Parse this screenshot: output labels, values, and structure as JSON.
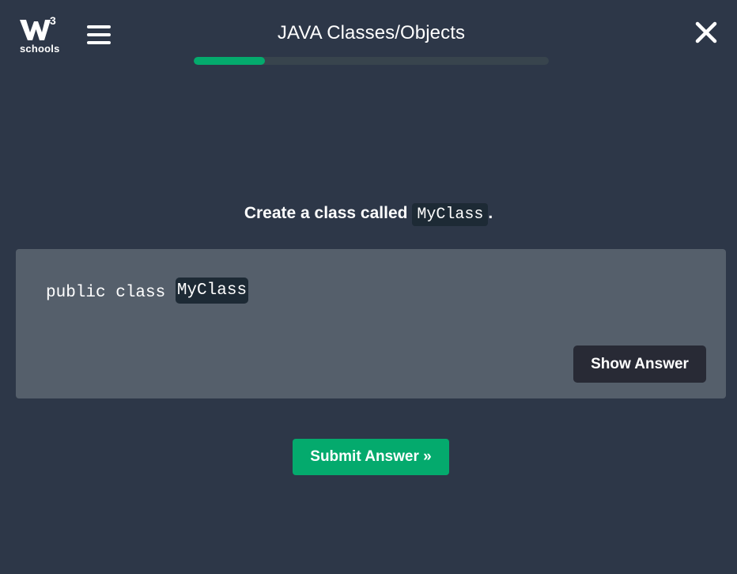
{
  "header": {
    "logo_text": "schools",
    "logo_sup": "3",
    "title": "JAVA Classes/Objects",
    "progress": 0.2,
    "menu_icon": "hamburger-menu-icon",
    "close_icon": "close-icon"
  },
  "question": {
    "prefix": "Create a class called ",
    "code": "MyClass",
    "suffix": "."
  },
  "exercise": {
    "code_prefix": "public class ",
    "answer_value": "MyClass",
    "show_answer_label": "Show Answer"
  },
  "submit": {
    "label": "Submit Answer »"
  },
  "colors": {
    "background": "#2d3748",
    "accent": "#04aa6d",
    "panel": "#555f6b",
    "code_bg": "#1d2a35",
    "dark_button": "#282a35"
  }
}
